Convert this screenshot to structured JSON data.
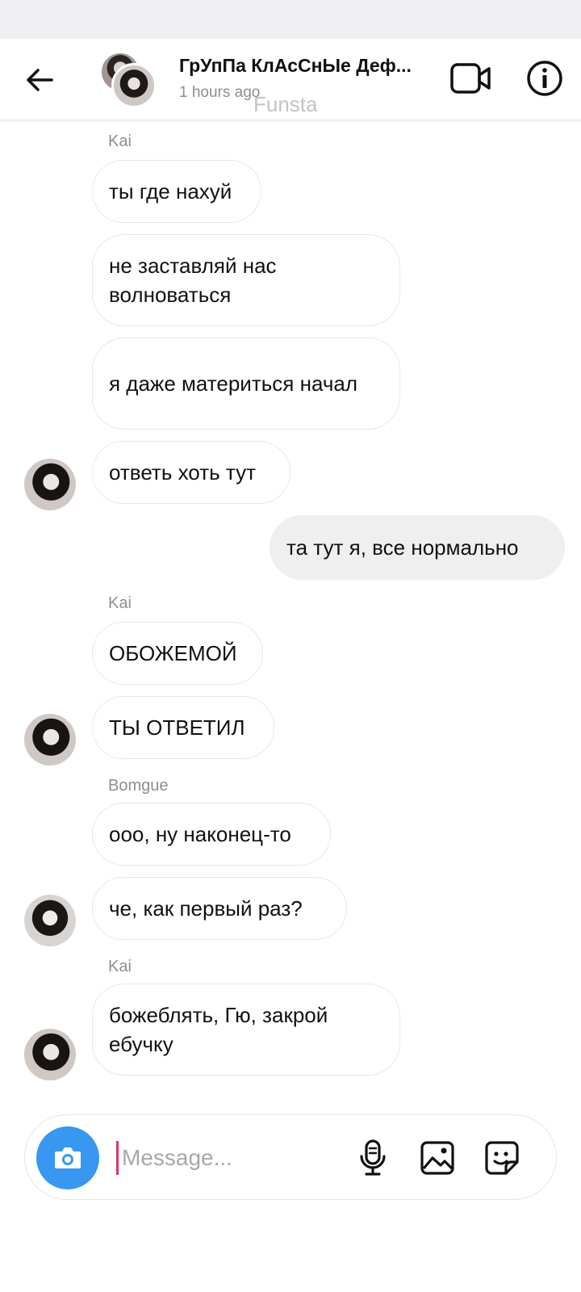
{
  "header": {
    "title": "ГрУпПа КлАсСнЫе Деф...",
    "subtitle": "1 hours ago",
    "watermark": "Funsta"
  },
  "messages": [
    {
      "sender": "Kai",
      "text": "ты где нахуй"
    },
    {
      "sender": "Kai",
      "text": "не заставляй нас волноваться"
    },
    {
      "sender": "Kai",
      "text": "я даже материться начал"
    },
    {
      "sender": "Kai",
      "text": "ответь хоть тут"
    },
    {
      "sender": "me",
      "text": "та тут я, все нормально"
    },
    {
      "sender": "Kai",
      "text": "ОБОЖЕМОЙ"
    },
    {
      "sender": "Kai",
      "text": "ТЫ ОТВЕТИЛ"
    },
    {
      "sender": "Bomgue",
      "text": "ооо, ну наконец-то"
    },
    {
      "sender": "Bomgue",
      "text": "че, как первый раз?"
    },
    {
      "sender": "Kai",
      "text": "божеблять, Гю, закрой ебучку"
    }
  ],
  "sender_labels": [
    "Kai",
    "Kai",
    "Bomgue",
    "Kai"
  ],
  "composer": {
    "placeholder": "Message..."
  },
  "icons": {
    "back": "arrow-left-icon",
    "video": "video-camera-icon",
    "info": "info-icon",
    "camera": "camera-icon",
    "mic": "microphone-icon",
    "gallery": "image-icon",
    "sticker": "sticker-icon"
  },
  "colors": {
    "accent": "#3897f0",
    "caret": "#e1306c",
    "own_bubble": "#efefef"
  }
}
